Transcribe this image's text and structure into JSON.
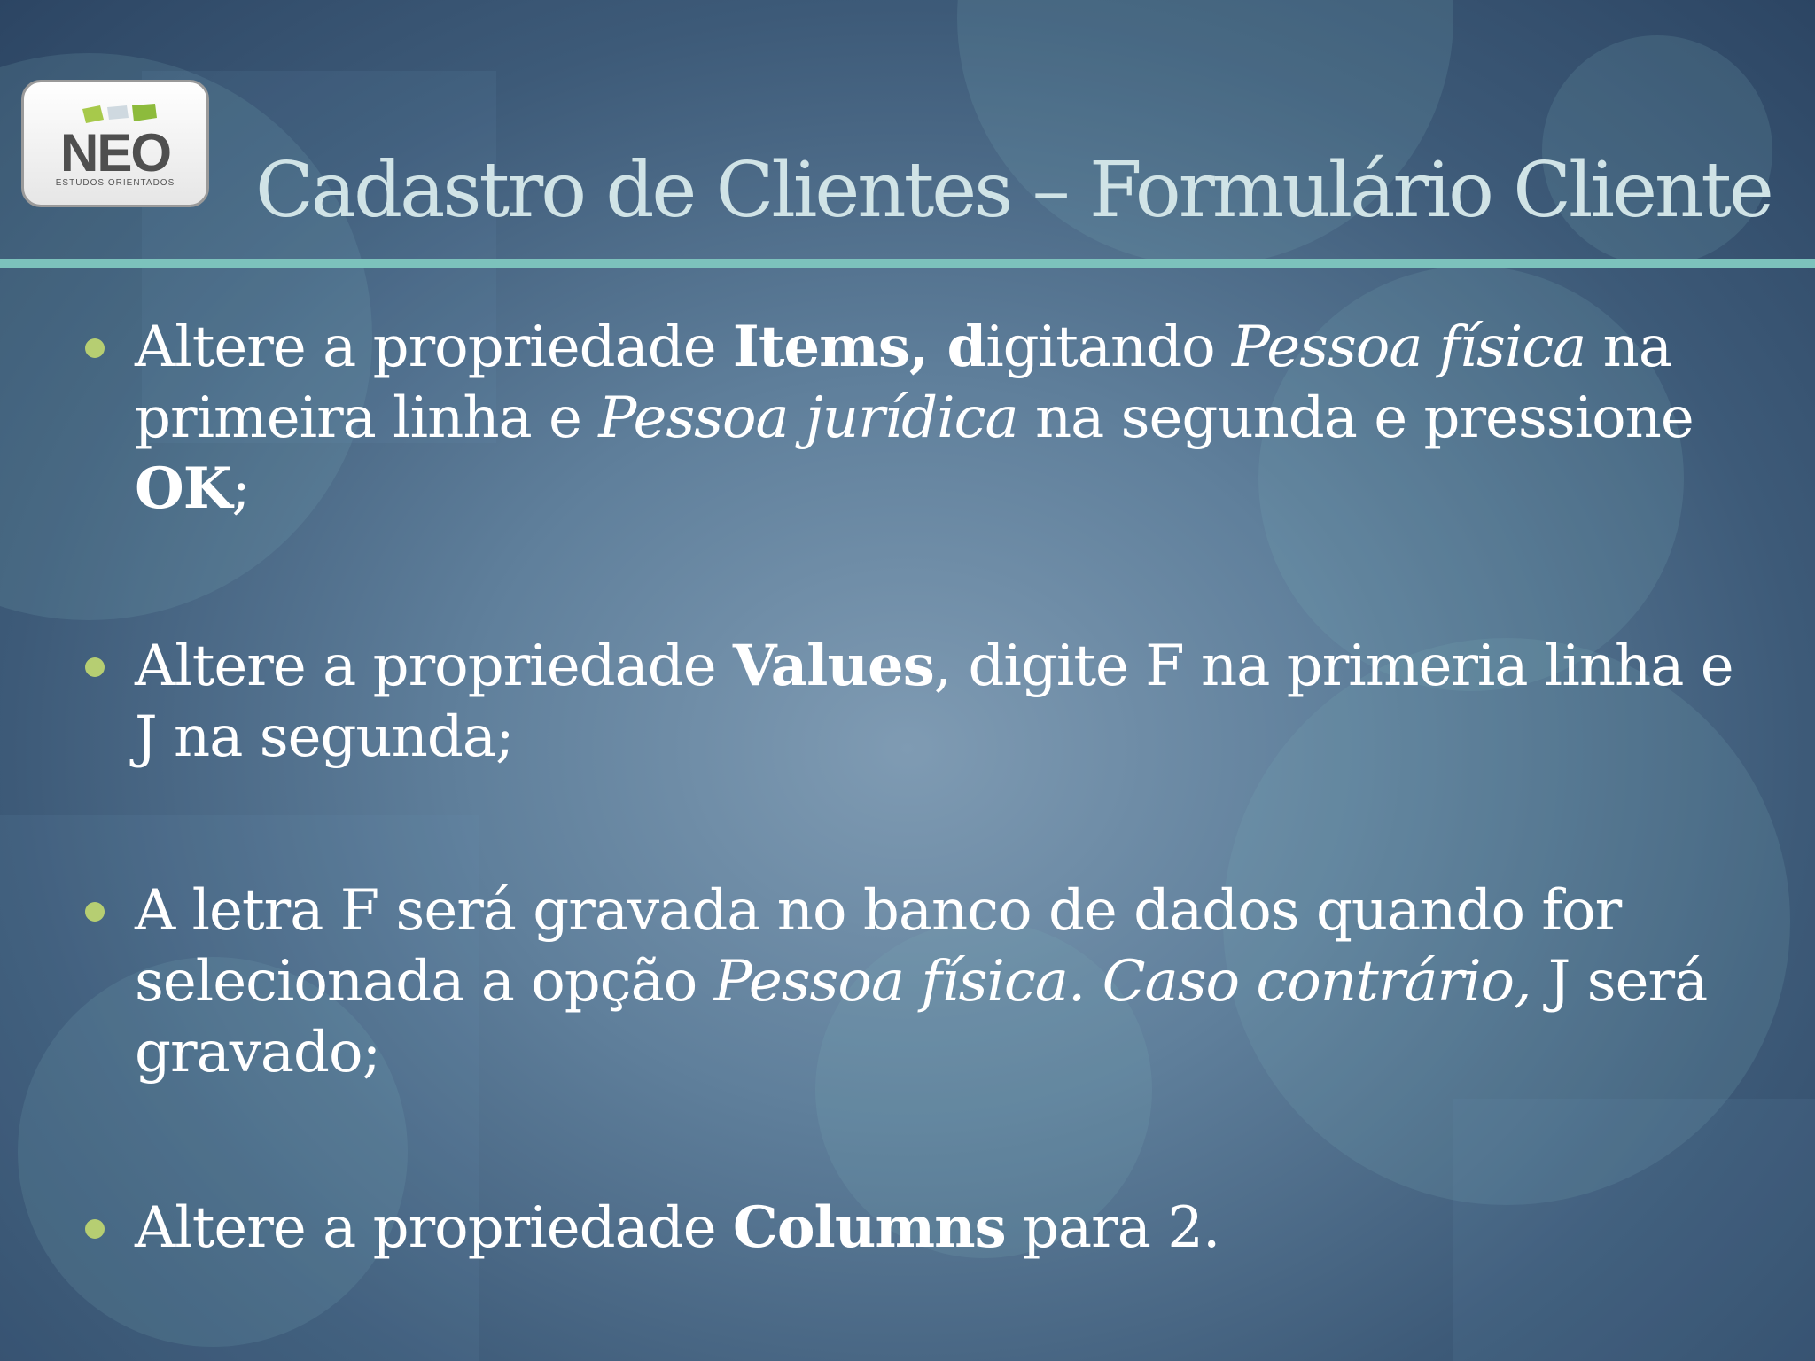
{
  "logo": {
    "name": "NEO",
    "tagline": "ESTUDOS ORIENTADOS"
  },
  "colors": {
    "title": "#d0e3e6",
    "rule": "#7cc2bc",
    "bullet_dot": "#b6ce72",
    "text": "#ffffff"
  },
  "slide": {
    "title": "Cadastro de Clientes – Formulário Cliente",
    "bullets": [
      {
        "segments": [
          "Altere a propriedade ",
          "Items, d",
          "igitando ",
          "Pessoa física",
          " na primeira linha e ",
          "Pessoa jurídica",
          " na segunda e pressione ",
          "OK",
          ";"
        ]
      },
      {
        "segments": [
          "Altere a propriedade ",
          "Values",
          ", digite F na primeria linha e J na segunda;"
        ]
      },
      {
        "segments": [
          "A letra F será gravada no banco de dados quando for selecionada a opção ",
          "Pessoa física. Caso contrário,",
          " J será gravado;"
        ]
      },
      {
        "segments": [
          "Altere a propriedade ",
          "Columns",
          " para 2."
        ]
      }
    ]
  }
}
